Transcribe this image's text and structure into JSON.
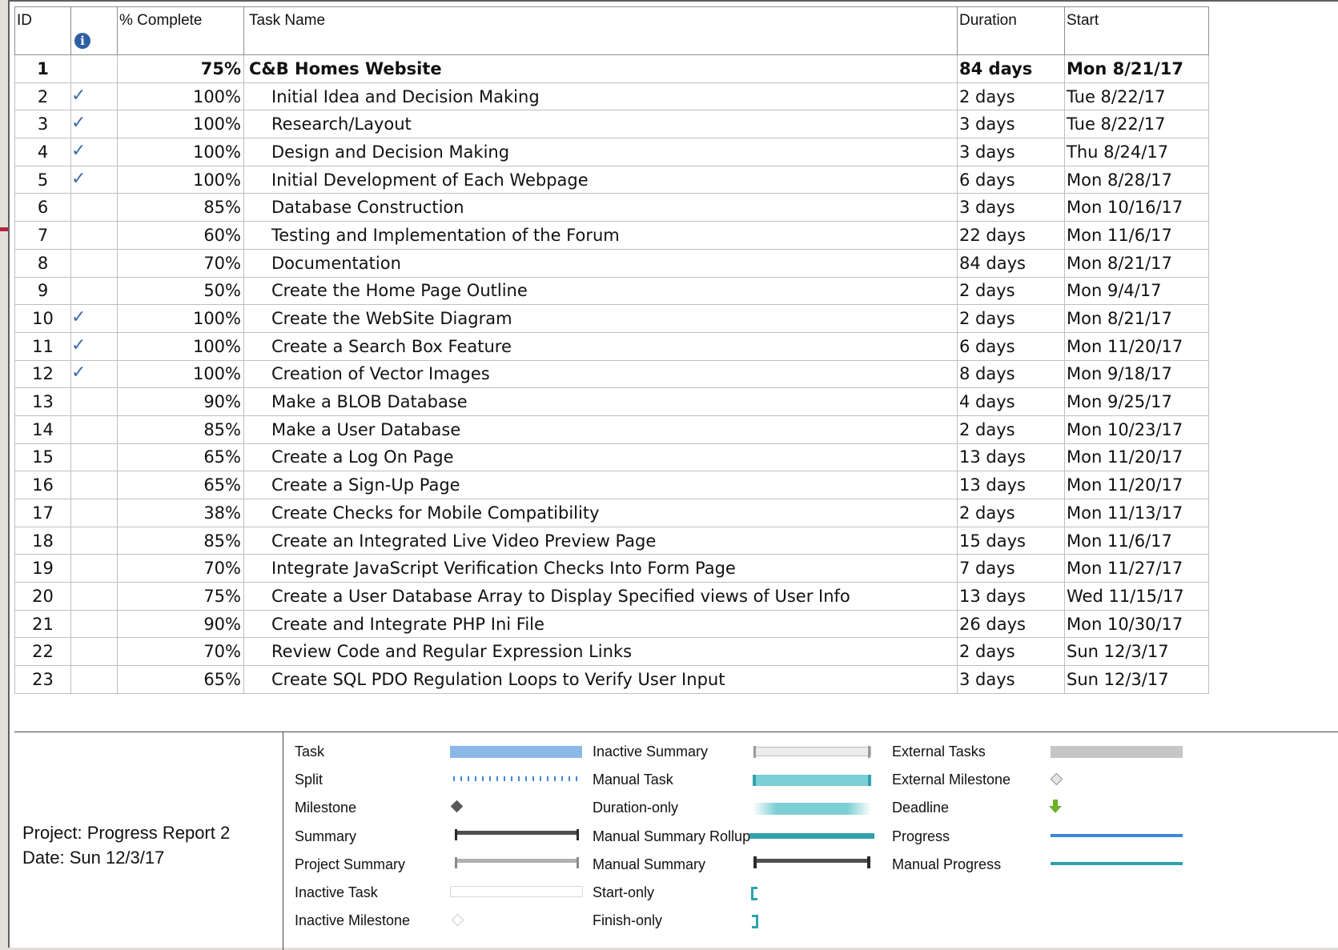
{
  "columns": {
    "id": "ID",
    "percent_complete": "% Complete",
    "task_name": "Task Name",
    "duration": "Duration",
    "start": "Start"
  },
  "tasks": [
    {
      "id": "1",
      "done": false,
      "pct": "75%",
      "name": "C&B Homes Website",
      "duration": "84 days",
      "start": "Mon 8/21/17",
      "summary": true
    },
    {
      "id": "2",
      "done": true,
      "pct": "100%",
      "name": "Initial Idea and Decision Making",
      "duration": "2 days",
      "start": "Tue 8/22/17"
    },
    {
      "id": "3",
      "done": true,
      "pct": "100%",
      "name": "Research/Layout",
      "duration": "3 days",
      "start": "Tue 8/22/17"
    },
    {
      "id": "4",
      "done": true,
      "pct": "100%",
      "name": "Design and Decision Making",
      "duration": "3 days",
      "start": "Thu 8/24/17"
    },
    {
      "id": "5",
      "done": true,
      "pct": "100%",
      "name": "Initial Development of Each Webpage",
      "duration": "6 days",
      "start": "Mon 8/28/17"
    },
    {
      "id": "6",
      "done": false,
      "pct": "85%",
      "name": "Database Construction",
      "duration": "3 days",
      "start": "Mon 10/16/17"
    },
    {
      "id": "7",
      "done": false,
      "pct": "60%",
      "name": "Testing and Implementation of the Forum",
      "duration": "22 days",
      "start": "Mon 11/6/17"
    },
    {
      "id": "8",
      "done": false,
      "pct": "70%",
      "name": "Documentation",
      "duration": "84 days",
      "start": "Mon 8/21/17"
    },
    {
      "id": "9",
      "done": false,
      "pct": "50%",
      "name": "Create the Home Page Outline",
      "duration": "2 days",
      "start": "Mon 9/4/17"
    },
    {
      "id": "10",
      "done": true,
      "pct": "100%",
      "name": "Create the WebSite Diagram",
      "duration": "2 days",
      "start": "Mon 8/21/17"
    },
    {
      "id": "11",
      "done": true,
      "pct": "100%",
      "name": "Create a Search Box Feature",
      "duration": "6 days",
      "start": "Mon 11/20/17"
    },
    {
      "id": "12",
      "done": true,
      "pct": "100%",
      "name": "Creation of Vector Images",
      "duration": "8 days",
      "start": "Mon 9/18/17"
    },
    {
      "id": "13",
      "done": false,
      "pct": "90%",
      "name": "Make a BLOB Database",
      "duration": "4 days",
      "start": "Mon 9/25/17"
    },
    {
      "id": "14",
      "done": false,
      "pct": "85%",
      "name": "Make a User Database",
      "duration": "2 days",
      "start": "Mon 10/23/17"
    },
    {
      "id": "15",
      "done": false,
      "pct": "65%",
      "name": "Create a Log On Page",
      "duration": "13 days",
      "start": "Mon 11/20/17"
    },
    {
      "id": "16",
      "done": false,
      "pct": "65%",
      "name": "Create a Sign-Up Page",
      "duration": "13 days",
      "start": "Mon 11/20/17"
    },
    {
      "id": "17",
      "done": false,
      "pct": "38%",
      "name": "Create Checks for Mobile Compatibility",
      "duration": "2 days",
      "start": "Mon 11/13/17"
    },
    {
      "id": "18",
      "done": false,
      "pct": "85%",
      "name": "Create an Integrated Live Video Preview Page",
      "duration": "15 days",
      "start": "Mon 11/6/17"
    },
    {
      "id": "19",
      "done": false,
      "pct": "70%",
      "name": "Integrate JavaScript Verification Checks Into Form Page",
      "duration": "7 days",
      "start": "Mon 11/27/17"
    },
    {
      "id": "20",
      "done": false,
      "pct": "75%",
      "name": "Create a User Database Array to Display Specified views of User Info",
      "duration": "13 days",
      "start": "Wed 11/15/17"
    },
    {
      "id": "21",
      "done": false,
      "pct": "90%",
      "name": "Create and Integrate PHP Ini File",
      "duration": "26 days",
      "start": "Mon 10/30/17"
    },
    {
      "id": "22",
      "done": false,
      "pct": "70%",
      "name": "Review Code and Regular Expression Links",
      "duration": "2 days",
      "start": "Sun 12/3/17"
    },
    {
      "id": "23",
      "done": false,
      "pct": "65%",
      "name": "Create SQL PDO Regulation Loops to Verify User Input",
      "duration": "3 days",
      "start": "Sun 12/3/17"
    }
  ],
  "project_info": {
    "project": "Project: Progress Report 2",
    "date": "Date: Sun 12/3/17"
  },
  "legend": {
    "col1": [
      "Task",
      "Split",
      "Milestone",
      "Summary",
      "Project Summary",
      "Inactive Task",
      "Inactive Milestone"
    ],
    "col2": [
      "Inactive Summary",
      "Manual Task",
      "Duration-only",
      "Manual Summary Rollup",
      "Manual Summary",
      "Start-only",
      "Finish-only"
    ],
    "col3": [
      "External Tasks",
      "External Milestone",
      "Deadline",
      "Progress",
      "Manual Progress"
    ]
  },
  "colors": {
    "task_bar": "#8ab9e8",
    "manual_task": "#7ccfd4",
    "rollup": "#31a2ad",
    "progress": "#3f86d9",
    "manual_progress": "#2ea3ad",
    "deadline": "#6fb12b",
    "external": "#c6c6c6",
    "check": "#3e6ea8",
    "accent": "#b1253f"
  }
}
